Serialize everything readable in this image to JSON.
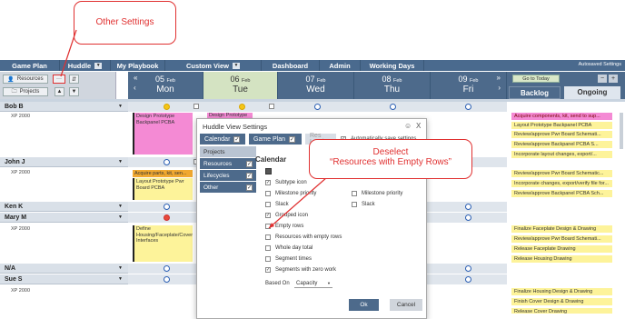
{
  "nav": {
    "items": [
      "Game Plan",
      "Huddle",
      "My Playbook",
      "Custom View",
      "Dashboard",
      "Admin",
      "Working Days"
    ],
    "autosaved": "Autosaved Settings"
  },
  "controls": {
    "resources_btn": "Resources",
    "projects_btn": "Projects",
    "more": "···"
  },
  "days": [
    {
      "num": "05",
      "mon": "Feb",
      "name": "Mon"
    },
    {
      "num": "06",
      "mon": "Feb",
      "name": "Tue"
    },
    {
      "num": "07",
      "mon": "Feb",
      "name": "Wed"
    },
    {
      "num": "08",
      "mon": "Feb",
      "name": "Thu"
    },
    {
      "num": "09",
      "mon": "Feb",
      "name": "Fri"
    }
  ],
  "right_panel": {
    "go_today": "Go to Today",
    "minus": "−",
    "plus": "+",
    "tab_backlog": "Backlog",
    "tab_ongoing": "Ongoing"
  },
  "resources": [
    {
      "name": "Bob B",
      "sub": "XP 2000"
    },
    {
      "name": "John J",
      "sub": "XP 2000"
    },
    {
      "name": "Ken K",
      "sub": ""
    },
    {
      "name": "Mary M",
      "sub": "XP 2000"
    },
    {
      "name": "N/A",
      "sub": ""
    },
    {
      "name": "Sue S",
      "sub": "XP 2000"
    }
  ],
  "tasks": {
    "bob": "Design Prototype Backpanel PCBA",
    "bob_tue": "Design Prototype",
    "john1": "Acquire parts, kit, sen...",
    "john2": "Layout Prototype Pwr Board PCBA",
    "mary": "Define Housing/Faceplate/Cover Interfaces"
  },
  "backlog": [
    "Acquire components, kit, send to sup...",
    "Layout Prototype Backpanel PCBA",
    "Review/approve Pwr Board Schemati...",
    "Review/approve Backpanel PCBA S...",
    "Incorporate layout changes, export/...",
    "Review/approve Pwr Board Schematic...",
    "Incorporate changes, export/verify file for...",
    "Review/approve Backpanel PCBA Sch...",
    "Finalize Faceplate Design & Drawing",
    "Review/approve Pwr Board Schemati...",
    "Release Faceplate Drawing",
    "Release Housing Drawing",
    "Finalize Housing Design & Drawing",
    "Finish Cover Design & Drawing",
    "Release Cover Drawing"
  ],
  "modal": {
    "title": "Huddle View Settings",
    "close": "X",
    "tabs": [
      "Calendar",
      "Game Plan",
      "Res Load"
    ],
    "auto_save": "Automatically save settings",
    "side": [
      "Projects",
      "Resources",
      "Lifecycles",
      "Other"
    ],
    "section": "Calendar",
    "options_left": [
      {
        "label": "Subtype icon",
        "checked": true
      },
      {
        "label": "Milestone priority",
        "checked": false
      },
      {
        "label": "Slack",
        "checked": false
      },
      {
        "label": "Grouped icon",
        "checked": true
      },
      {
        "label": "Empty rows",
        "checked": false
      },
      {
        "label": "Resources with empty rows",
        "checked": false
      },
      {
        "label": "Whole day total",
        "checked": false
      },
      {
        "label": "Segment times",
        "checked": false
      },
      {
        "label": "Segments with zero work",
        "checked": true
      }
    ],
    "options_right": [
      {
        "label": "Milestone priority",
        "checked": false
      },
      {
        "label": "Slack",
        "checked": false
      }
    ],
    "based_on_label": "Based On",
    "based_on_value": "Capacity",
    "ok": "Ok",
    "cancel": "Cancel"
  },
  "callouts": {
    "other_settings": "Other Settings",
    "deselect_line1": "Deselect",
    "deselect_line2": "“Resources with Empty Rows”"
  }
}
